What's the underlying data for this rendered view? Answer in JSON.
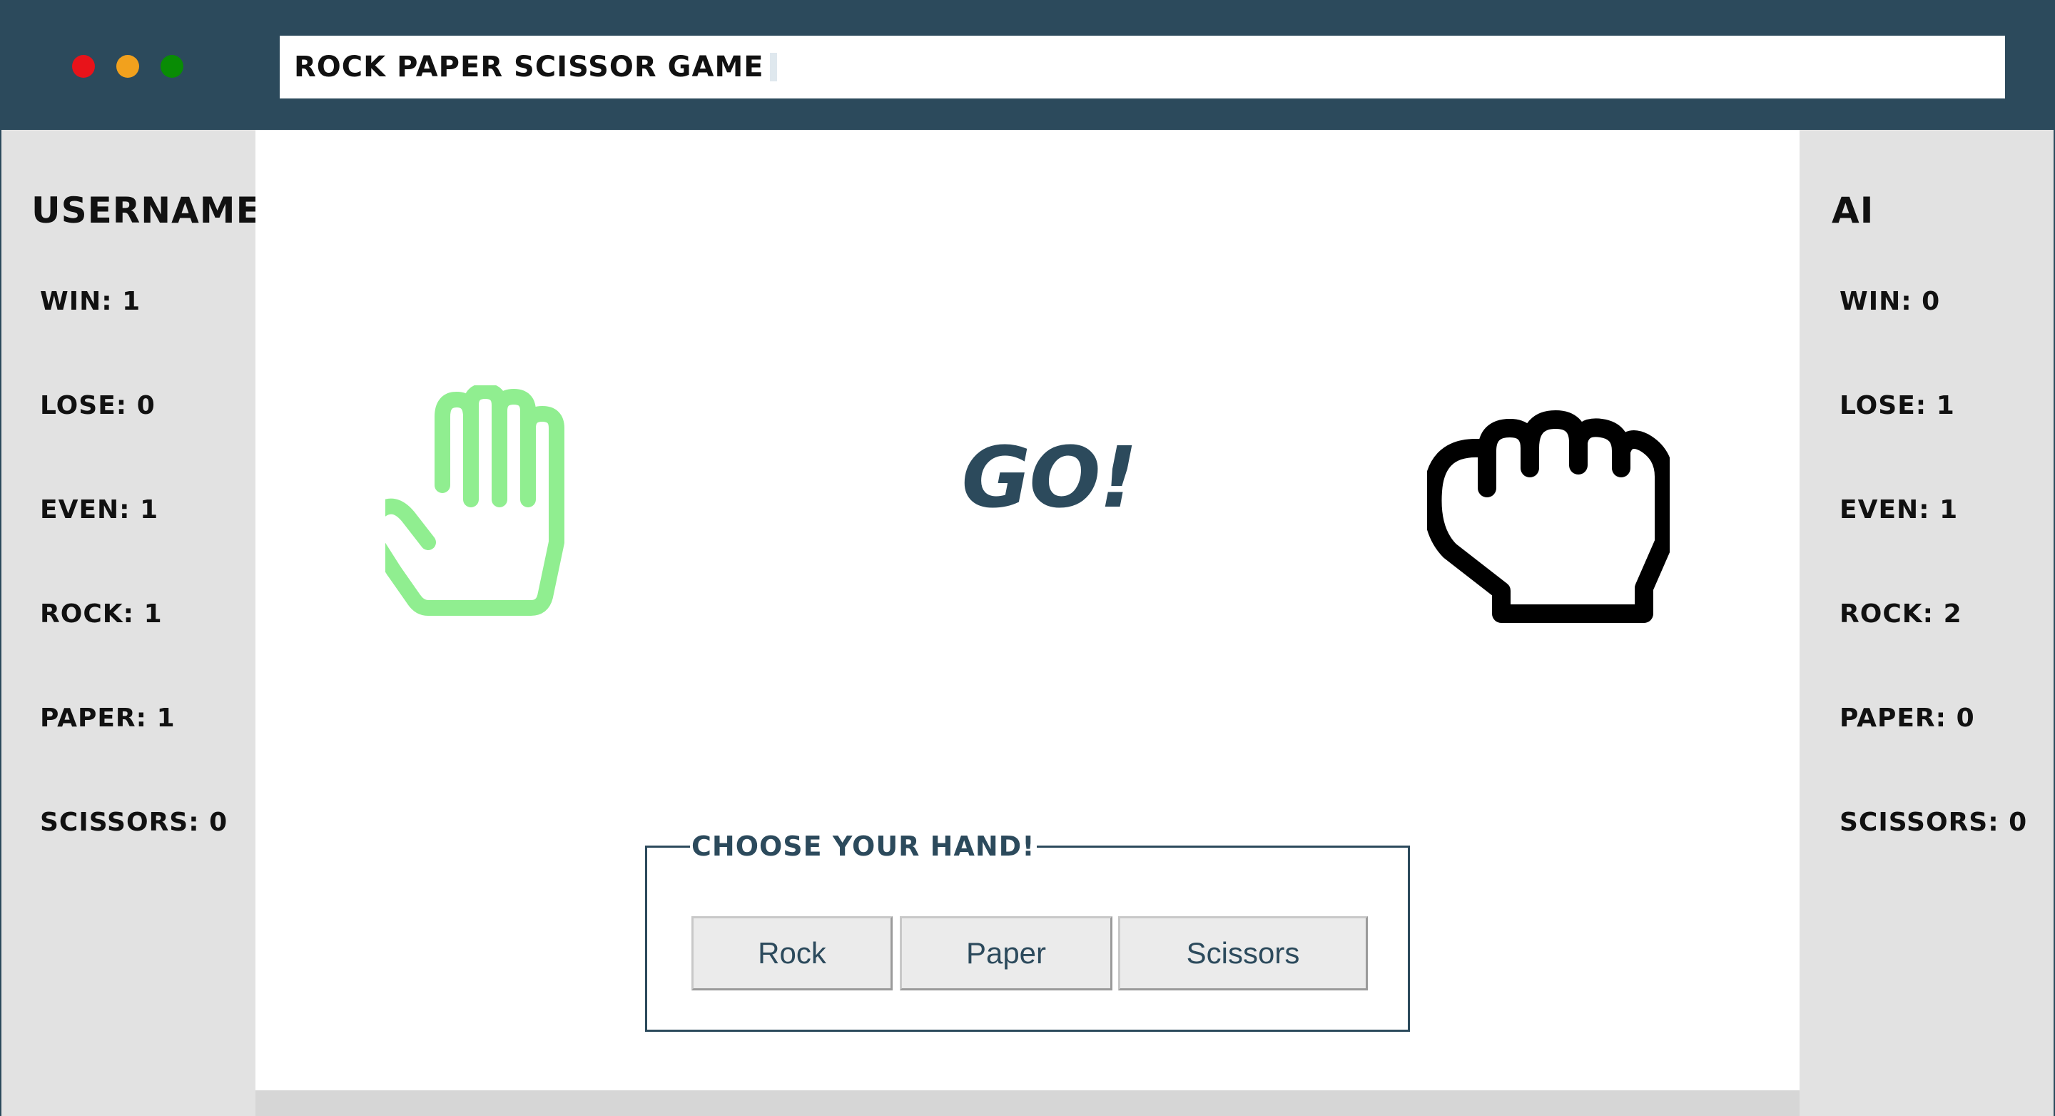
{
  "window": {
    "traffic_lights": {
      "close_color": "#e8131a",
      "minimize_color": "#f2a11d",
      "zoom_color": "#098c05"
    },
    "title": "Rock paper scissor game"
  },
  "user_panel": {
    "name": "username",
    "stats": [
      {
        "label": "Win",
        "value": "1",
        "text": "Win: 1"
      },
      {
        "label": "Lose",
        "value": "0",
        "text": "Lose: 0"
      },
      {
        "label": "Even",
        "value": "1",
        "text": "Even: 1"
      },
      {
        "label": "Rock",
        "value": "1",
        "text": "Rock: 1"
      },
      {
        "label": "Paper",
        "value": "1",
        "text": "Paper: 1"
      },
      {
        "label": "Scissors",
        "value": "0",
        "text": "Scissors: 0"
      }
    ]
  },
  "ai_panel": {
    "name": "AI",
    "stats": [
      {
        "label": "Win",
        "value": "0",
        "text": "Win: 0"
      },
      {
        "label": "Lose",
        "value": "1",
        "text": "Lose: 1"
      },
      {
        "label": "Even",
        "value": "1",
        "text": "Even: 1"
      },
      {
        "label": "Rock",
        "value": "2",
        "text": "Rock: 2"
      },
      {
        "label": "Paper",
        "value": "0",
        "text": "Paper: 0"
      },
      {
        "label": "Scissors",
        "value": "0",
        "text": "Scissors: 0"
      }
    ]
  },
  "arena": {
    "user_hand": {
      "icon": "paper-hand-icon",
      "color": "#90ee90"
    },
    "ai_hand": {
      "icon": "rock-fist-icon",
      "color": "#000000"
    },
    "status": "GO!"
  },
  "chooser": {
    "legend": "Choose your hand!",
    "buttons": [
      {
        "label": "Rock"
      },
      {
        "label": "Paper"
      },
      {
        "label": "Scissors"
      }
    ]
  },
  "colors": {
    "header": "#2c4a5c",
    "sidebar": "#e2e2e2",
    "accent": "#2c4a5c"
  }
}
